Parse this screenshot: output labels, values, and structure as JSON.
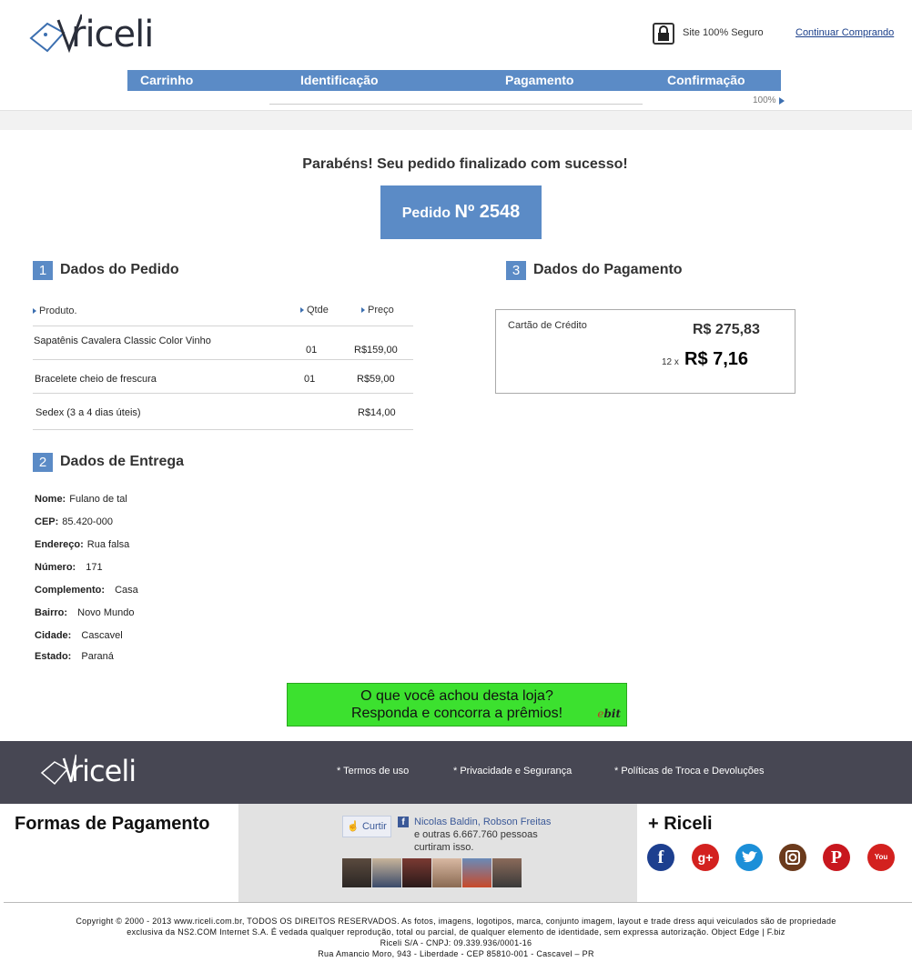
{
  "header": {
    "logo_text": "riceli",
    "secure_text": "Site 100% Seguro",
    "continue_link": "Continuar Comprando"
  },
  "steps": {
    "items": [
      "Carrinho",
      "Identificação",
      "Pagamento",
      "Confirmação"
    ],
    "progress": "100%",
    "progress_value": 100
  },
  "success": {
    "title": "Parabéns! Seu pedido finalizado com sucesso!",
    "order_label": "Pedido",
    "order_number": "Nº 2548"
  },
  "order_section": {
    "number": "1",
    "title": "Dados do Pedido",
    "col_product": "Produto.",
    "col_qty": "Qtde",
    "col_price": "Preço",
    "rows": [
      {
        "product": "Sapatênis Cavalera Classic Color Vinho",
        "qty": "01",
        "price": "R$159,00"
      },
      {
        "product": "Bracelete cheio de frescura",
        "qty": "01",
        "price": "R$59,00"
      },
      {
        "product": "Sedex (3 a 4 dias úteis)",
        "qty": "",
        "price": "R$14,00"
      }
    ]
  },
  "delivery_section": {
    "number": "2",
    "title": "Dados de Entrega",
    "fields": [
      {
        "label": "Nome:",
        "value": "Fulano de tal"
      },
      {
        "label": "CEP:",
        "value": "85.420-000"
      },
      {
        "label": "Endereço:",
        "value": "Rua falsa"
      },
      {
        "label": "Número:",
        "value": "171"
      },
      {
        "label": "Complemento:",
        "value": "Casa"
      },
      {
        "label": "Bairro:",
        "value": "Novo Mundo"
      },
      {
        "label": "Cidade:",
        "value": "Cascavel"
      },
      {
        "label": "Estado:",
        "value": "Paraná"
      }
    ]
  },
  "payment_section": {
    "number": "3",
    "title": "Dados do Pagamento",
    "method": "Cartão de Crédito",
    "total": "R$ 275,83",
    "installments": "12 x",
    "installment_value": "R$ 7,16"
  },
  "ebit": {
    "line1": "O que você achou desta loja?",
    "line2": "Responda e concorra a prêmios!",
    "logo_e": "e",
    "logo_rest": "bit"
  },
  "footer": {
    "logo_text": "riceli",
    "links": [
      "* Termos de uso",
      "* Privacidade e Segurança",
      "* Políticas de Troca e Devoluções"
    ],
    "payments_title": "Formas de Pagamento",
    "fb": {
      "like_label": "Curtir",
      "icon": "f",
      "names": "Nicolas Baldin, Robson Freitas",
      "line2": "e outras 6.667.760 pessoas",
      "line3": "curtiram isso."
    },
    "plus_title": "+ Riceli",
    "social": [
      {
        "name": "facebook-icon",
        "glyph": "f",
        "color": "#1d3f8f"
      },
      {
        "name": "google-plus-icon",
        "glyph": "g+",
        "color": "#d3211f"
      },
      {
        "name": "twitter-icon",
        "glyph": "t",
        "color": "#1c8fd8"
      },
      {
        "name": "instagram-icon",
        "glyph": "◙",
        "color": "#6b3a1c"
      },
      {
        "name": "pinterest-icon",
        "glyph": "P",
        "color": "#c8171e"
      },
      {
        "name": "youtube-icon",
        "glyph": "You",
        "color": "#d3211f"
      }
    ],
    "copyright": [
      "Copyright © 2000 - 2013 www.riceli.com.br, TODOS OS DIREITOS RESERVADOS. As fotos, imagens, logotipos, marca, conjunto imagem, layout e trade dress aqui veiculados são de propriedade",
      "exclusiva da NS2.COM Internet S.A. É vedada qualquer reprodução, total ou parcial, de qualquer elemento de identidade, sem expressa autorização. Object Edge | F.biz",
      "Riceli S/A - CNPJ: 09.339.936/0001-16",
      "Rua Amancio Moro, 943 - Liberdade - CEP 85810-001 - Cascavel – PR"
    ]
  },
  "colors": {
    "accent": "#5b8bc6",
    "footer_bar": "#474753",
    "ebit_green": "#3ce12f"
  }
}
